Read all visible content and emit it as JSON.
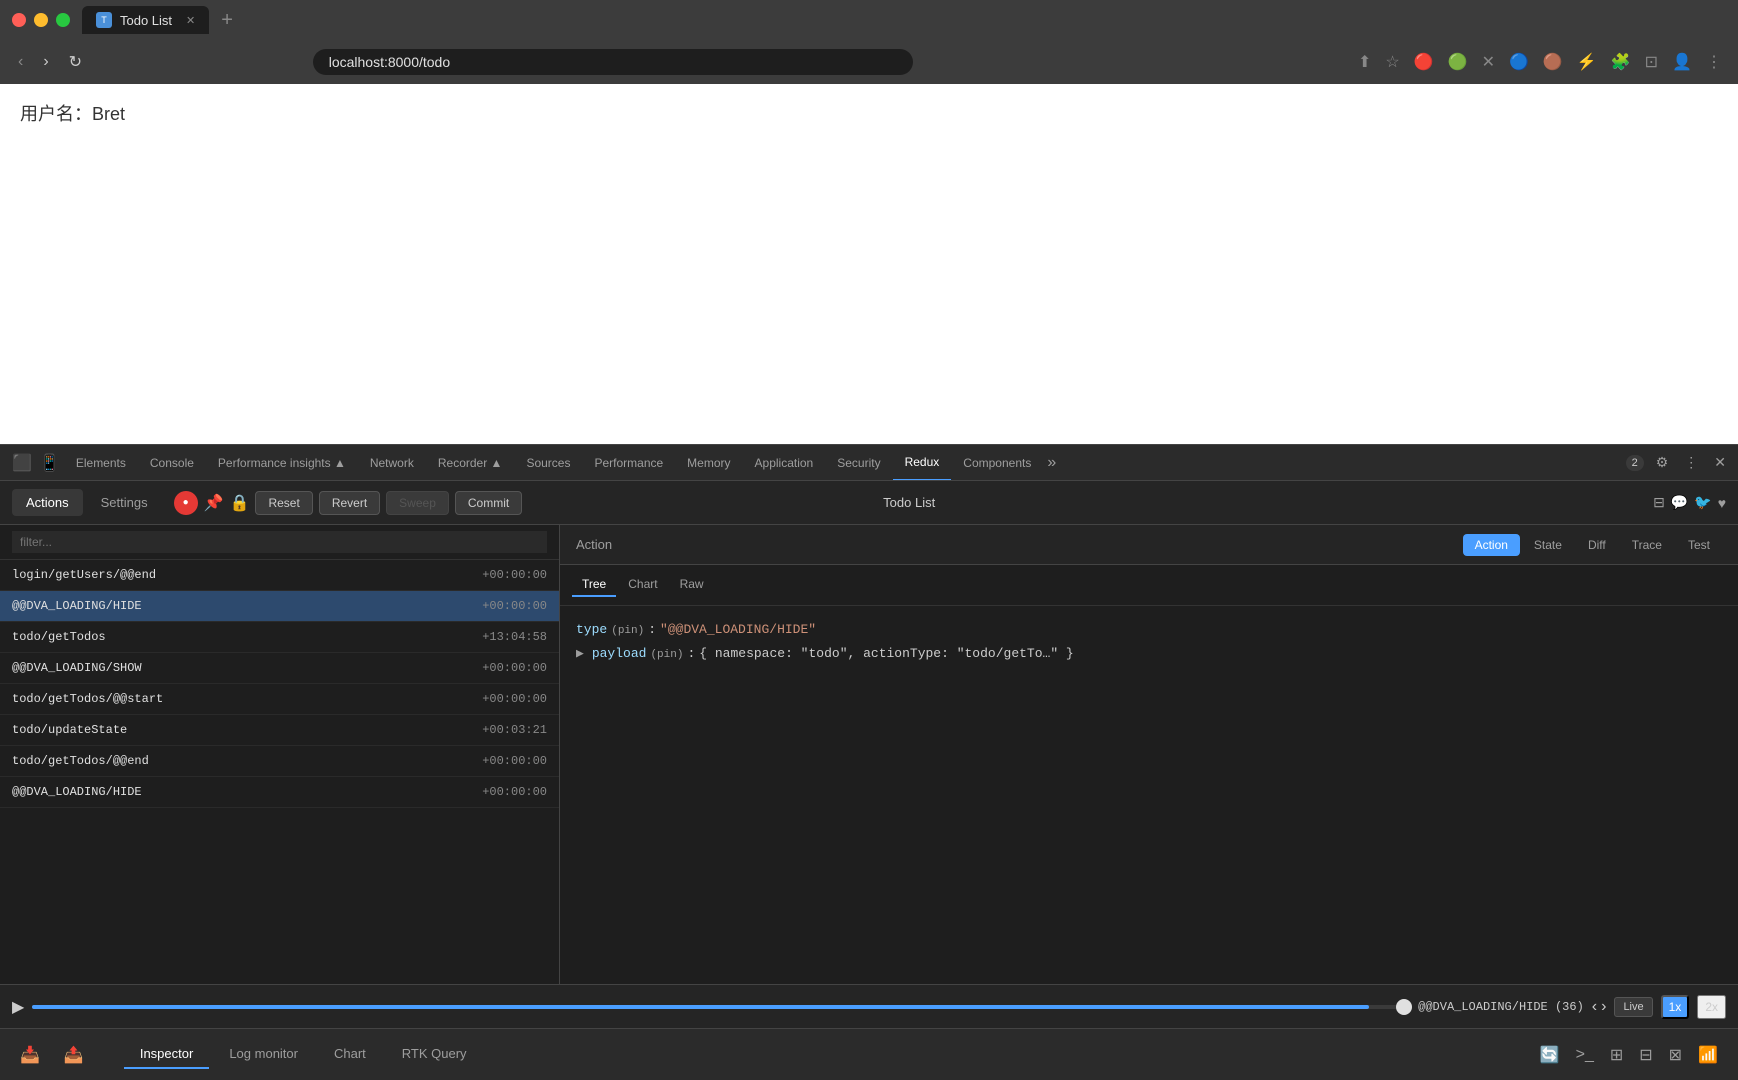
{
  "browser": {
    "title": "Todo List",
    "url": "localhost:8000/todo",
    "tab_label": "Todo List",
    "new_tab_label": "+",
    "nav_back": "‹",
    "nav_forward": "›",
    "nav_refresh": "↻"
  },
  "webpage": {
    "username_label": "用户名：Bret"
  },
  "devtools": {
    "tabs": [
      {
        "label": "Elements"
      },
      {
        "label": "Console"
      },
      {
        "label": "Performance insights ▲"
      },
      {
        "label": "Network"
      },
      {
        "label": "Recorder ▲"
      },
      {
        "label": "Sources"
      },
      {
        "label": "Performance"
      },
      {
        "label": "Memory"
      },
      {
        "label": "Application"
      },
      {
        "label": "Security"
      },
      {
        "label": "Redux"
      },
      {
        "label": "Components"
      },
      {
        "label": "»"
      }
    ],
    "active_tab": "Redux",
    "badge": "2"
  },
  "redux": {
    "subtabs": [
      {
        "label": "Actions"
      },
      {
        "label": "Settings"
      }
    ],
    "active_subtab": "Actions",
    "toolbar": {
      "reset_label": "Reset",
      "revert_label": "Revert",
      "sweep_label": "Sweep",
      "commit_label": "Commit",
      "title": "Todo List"
    },
    "filter_placeholder": "filter...",
    "actions_list": [
      {
        "name": "login/getUsers/@@end",
        "time": "+00:00:00"
      },
      {
        "name": "@@DVA_LOADING/HIDE",
        "time": "+00:00:00"
      },
      {
        "name": "todo/getTodos",
        "time": "+13:04:58"
      },
      {
        "name": "@@DVA_LOADING/SHOW",
        "time": "+00:00:00"
      },
      {
        "name": "todo/getTodos/@@start",
        "time": "+00:00:00"
      },
      {
        "name": "todo/updateState",
        "time": "+00:03:21"
      },
      {
        "name": "todo/getTodos/@@end",
        "time": "+00:00:00"
      },
      {
        "name": "@@DVA_LOADING/HIDE",
        "time": "+00:00:00"
      }
    ],
    "selected_action_index": 1,
    "inspector": {
      "title": "Action",
      "tabs": [
        {
          "label": "Action"
        },
        {
          "label": "State"
        },
        {
          "label": "Diff"
        },
        {
          "label": "Trace"
        },
        {
          "label": "Test"
        }
      ],
      "active_tab": "Action",
      "tree_tabs": [
        {
          "label": "Tree"
        },
        {
          "label": "Chart"
        },
        {
          "label": "Raw"
        }
      ],
      "active_tree_tab": "Tree",
      "tree": {
        "type_key": "type",
        "type_paren": "(pin)",
        "type_colon": ":",
        "type_value": "\"@@DVA_LOADING/HIDE\"",
        "payload_key": "payload",
        "payload_paren": "(pin)",
        "payload_colon": ":",
        "payload_value": "{ namespace: \"todo\", actionType: \"todo/getTo…\" }"
      }
    },
    "status_bar": {
      "action_name": "@@DVA_LOADING/HIDE",
      "count": "(36)",
      "live_label": "Live",
      "speed_1x": "1x",
      "speed_2x": "2x"
    },
    "bottom_tabs": [
      {
        "label": "Inspector"
      },
      {
        "label": "Log monitor"
      },
      {
        "label": "Chart"
      },
      {
        "label": "RTK Query"
      }
    ],
    "active_bottom_tab": "Inspector"
  }
}
